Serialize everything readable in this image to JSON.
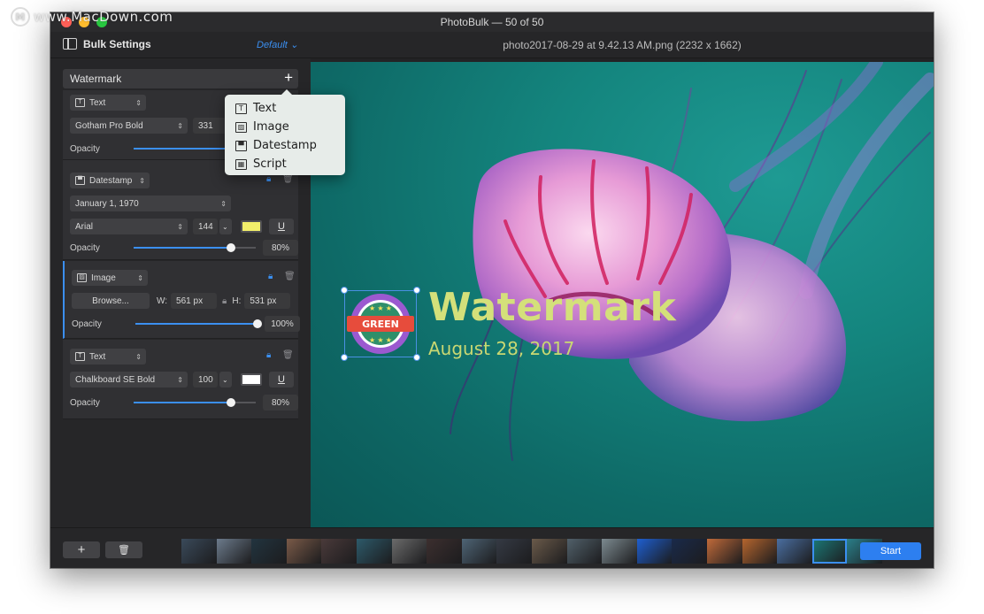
{
  "site_watermark": "www.MacDown.com",
  "window": {
    "title": "PhotoBulk — 50 of 50"
  },
  "toolbar": {
    "section_title": "Bulk Settings",
    "preset": "Default",
    "filename": "photo2017-08-29 at 9.42.13 AM.png (2232 x 1662)"
  },
  "sidebar": {
    "section_label": "Watermark",
    "add_symbol": "+",
    "cards": [
      {
        "type_label": "Text",
        "font": "Gotham Pro Bold",
        "size": "331",
        "opacity_label": "Opacity",
        "opacity_value": 0.8
      },
      {
        "type_label": "Datestamp",
        "date_format": "January 1, 1970",
        "font": "Arial",
        "size": "144",
        "swatch_color": "#f3f06b",
        "underline": "U",
        "opacity_label": "Opacity",
        "opacity_text": "80%",
        "opacity_value": 0.8
      },
      {
        "type_label": "Image",
        "browse": "Browse...",
        "w_label": "W:",
        "w_value": "561 px",
        "h_label": "H:",
        "h_value": "531 px",
        "opacity_label": "Opacity",
        "opacity_text": "100%",
        "opacity_value": 1.0
      },
      {
        "type_label": "Text",
        "font": "Chalkboard SE Bold",
        "size": "100",
        "swatch_color": "#ffffff",
        "underline": "U",
        "opacity_label": "Opacity",
        "opacity_text": "80%",
        "opacity_value": 0.8
      }
    ]
  },
  "add_menu": {
    "items": [
      "Text",
      "Image",
      "Datestamp",
      "Script"
    ]
  },
  "canvas": {
    "watermark_text": "Watermark",
    "watermark_date": "August 28, 2017",
    "badge_text": "GREEN"
  },
  "bottombar": {
    "add_symbol": "+",
    "start_label": "Start",
    "thumbnail_colors": [
      "#3a4a5a",
      "#6c7b8c",
      "#22343f",
      "#7a5a48",
      "#4a3a3a",
      "#2d5a6a",
      "#6b6b6b",
      "#3c2f2f",
      "#4e6475",
      "#353a44",
      "#6a5a4a",
      "#51606a",
      "#7c8a90",
      "#1e5fd0",
      "#1a2a4a",
      "#c06a3a",
      "#b5652e",
      "#4a6ea0",
      "#1b7a78",
      "#2a7f8a"
    ]
  },
  "colors": {
    "accent": "#3b8ff0",
    "canvas_teal": "#14857e",
    "watermark_yellow": "#d4e07a"
  }
}
